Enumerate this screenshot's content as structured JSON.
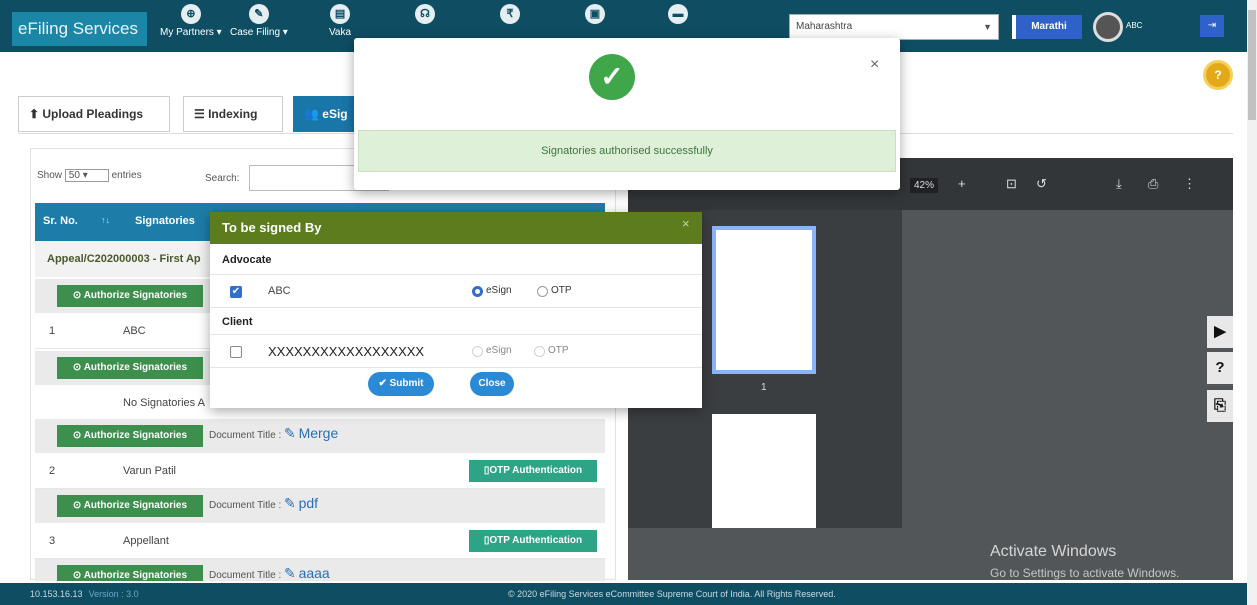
{
  "navbar": {
    "brand": "eFiling Services",
    "items": [
      {
        "icon": "handshake-icon",
        "glyph": "⊕",
        "label": "My Partners ▾"
      },
      {
        "icon": "pencil-icon",
        "glyph": "✎",
        "label": "Case Filing ▾"
      },
      {
        "icon": "document-icon",
        "glyph": "▤",
        "label": "Vaka"
      },
      {
        "icon": "headset-icon",
        "glyph": "☊",
        "label": ""
      },
      {
        "icon": "rupee-icon",
        "glyph": "₹",
        "label": ""
      },
      {
        "icon": "file-icon",
        "glyph": "▣",
        "label": ""
      },
      {
        "icon": "briefcase-icon",
        "glyph": "▬",
        "label": ""
      }
    ],
    "state": "Maharashtra",
    "language": "Marathi",
    "user": "ABC"
  },
  "tabs": [
    {
      "label": "⬆ Upload Pleadings"
    },
    {
      "label": "☰ Indexing"
    },
    {
      "label": "👥 eSig"
    }
  ],
  "table": {
    "length_label_pre": "Show",
    "length_value": "50",
    "length_label_post": "entries",
    "search_label": "Search:",
    "headers": {
      "sr": "Sr. No.",
      "sort": "↑↓",
      "signatories": "Signatories"
    },
    "group_title": "Appeal/C202000003 - First Ap",
    "authorize_label": "⊙ Authorize Signatories",
    "doc_title_label": "Document Title :",
    "rows": [
      {
        "sr": "1",
        "name": "ABC"
      },
      {
        "sr": "",
        "name": "No Signatories A"
      },
      {
        "sr": "2",
        "name": "Varun Patil"
      },
      {
        "sr": "3",
        "name": "Appellant"
      }
    ],
    "doc_links": [
      "Merge",
      "pdf",
      "aaaa"
    ],
    "otp_label": "▯OTP Authentication"
  },
  "pdf": {
    "zoom": "42%",
    "page_number": "1"
  },
  "watermark": {
    "title": "Activate Windows",
    "subtitle": "Go to Settings to activate Windows."
  },
  "footer": {
    "ip": "10.153.16.13",
    "version": "Version : 3.0",
    "copyright": "© 2020 eFiling Services eCommittee Supreme Court of India. All Rights Reserved."
  },
  "success_modal": {
    "message": "Signatories authorised successfully",
    "close": "×"
  },
  "sign_modal": {
    "title": "To be signed By",
    "close": "×",
    "advocate_label": "Advocate",
    "advocate_name": "ABC",
    "client_label": "Client",
    "client_name": "XXXXXXXXXXXXXXXXXX",
    "esign_label": "eSign",
    "otp_label": "OTP",
    "submit_label": "✔ Submit",
    "close_label": "Close"
  },
  "colors": {
    "navbar": "#0f4d63",
    "modal_header": "#5d7c1e",
    "success": "#3fa64a",
    "table_header": "#1e7ca8"
  }
}
